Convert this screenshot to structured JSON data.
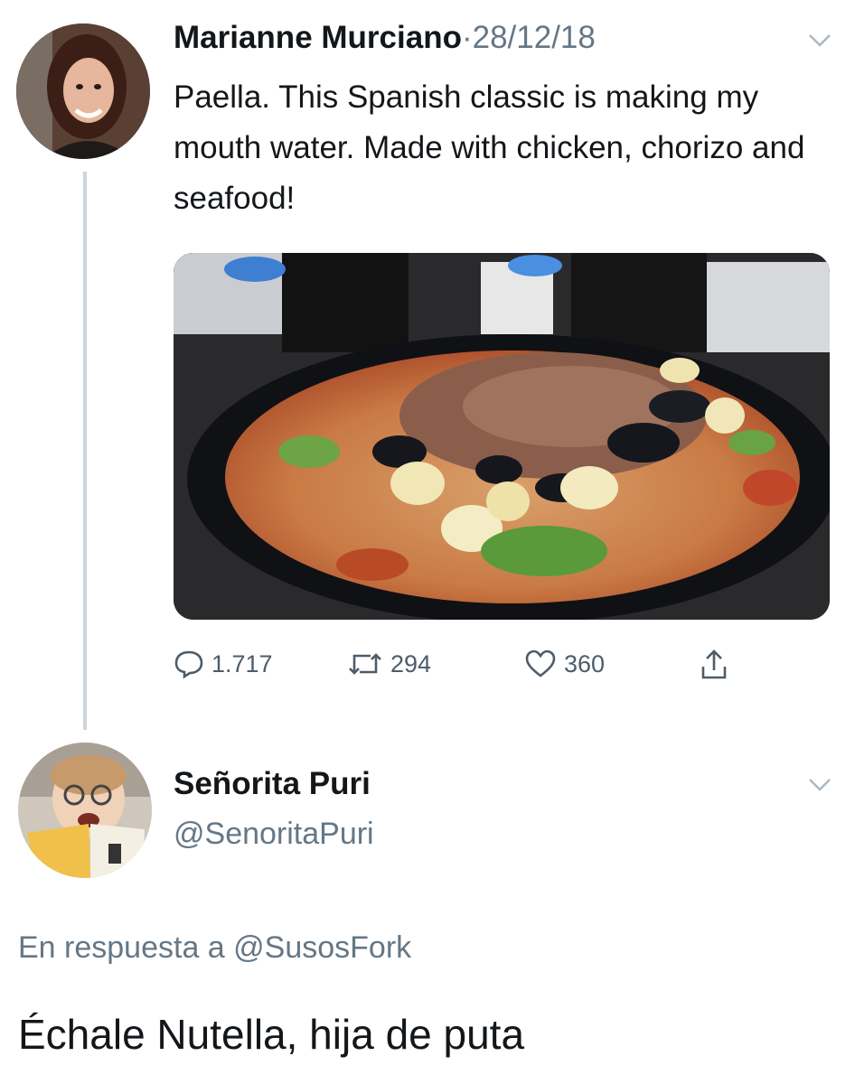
{
  "tweet": {
    "author_name": "Marianne Murciano",
    "separator": "·",
    "date": "28/12/18",
    "text": "Paella. This Spanish classic is making my mouth water. Made with chicken, chorizo and seafood!",
    "image_alt": "paella",
    "stats": {
      "replies": "1.717",
      "retweets": "294",
      "likes": "360"
    },
    "icons": {
      "reply": "reply-icon",
      "retweet": "retweet-icon",
      "like": "heart-icon",
      "share": "share-icon",
      "menu": "chevron-down-icon"
    }
  },
  "reply": {
    "author_name": "Señorita Puri",
    "handle": "@SenoritaPuri",
    "in_reply_to_prefix": "En respuesta a",
    "in_reply_to_handle": "@SusosFork",
    "text": "Échale Nutella, hija de puta"
  },
  "colors": {
    "text": "#14171a",
    "secondary": "#657786",
    "thread_line": "#ccd6dd"
  }
}
